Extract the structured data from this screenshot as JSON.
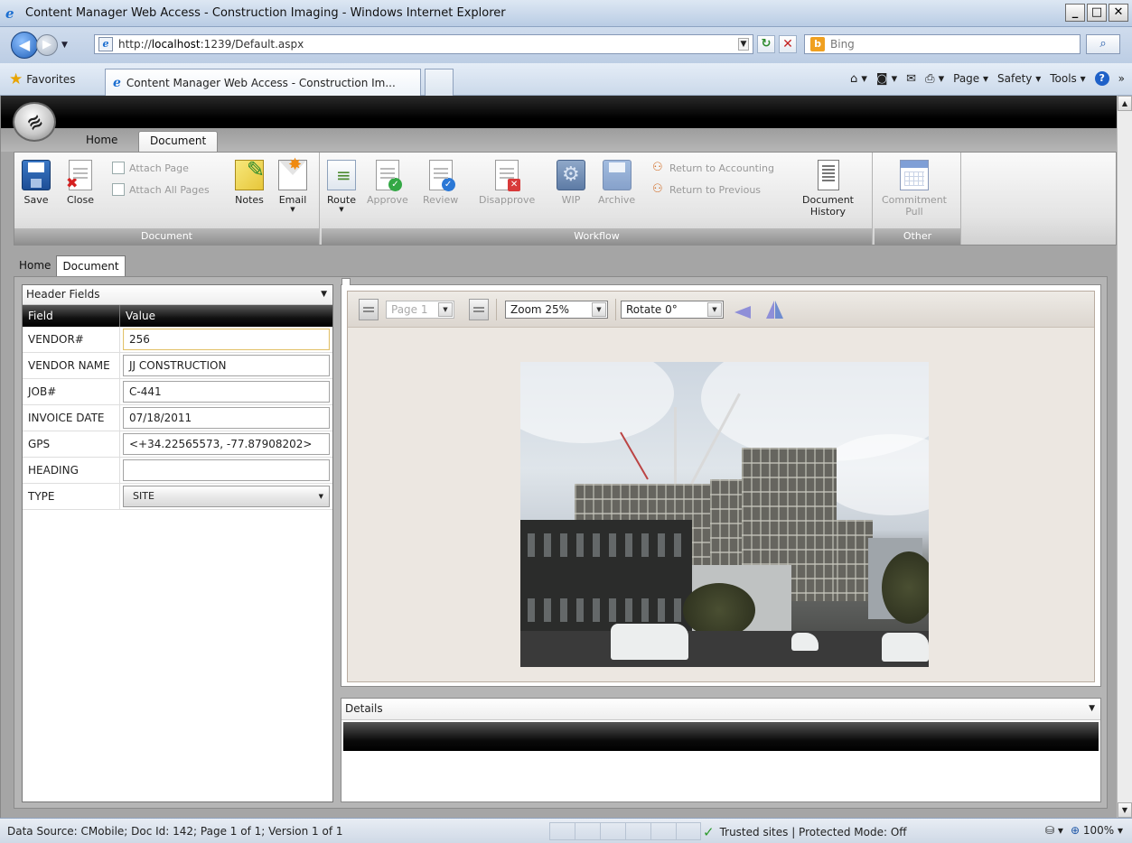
{
  "browser": {
    "window_title": "Content Manager Web Access - Construction Imaging - Windows Internet Explorer",
    "url_prefix": "http://",
    "url_host": "localhost",
    "url_rest": ":1239/Default.aspx",
    "search_placeholder": "Bing",
    "favorites_label": "Favorites",
    "tab_title": "Content Manager Web Access - Construction Im...",
    "cmd_page": "Page ▾",
    "cmd_safety": "Safety ▾",
    "cmd_tools": "Tools ▾",
    "win_min": "_",
    "win_max": "□",
    "win_close": "✕"
  },
  "ribbon": {
    "tabs": {
      "home": "Home",
      "document": "Document"
    },
    "groups": {
      "document": "Document",
      "workflow": "Workflow",
      "other": "Other"
    },
    "buttons": {
      "save": "Save",
      "close": "Close",
      "attach_page": "Attach Page",
      "attach_all_pages": "Attach All Pages",
      "notes": "Notes",
      "email": "Email",
      "route": "Route",
      "approve": "Approve",
      "review": "Review",
      "disapprove": "Disapprove",
      "wip": "WIP",
      "archive": "Archive",
      "return_to_accounting": "Return to Accounting",
      "return_to_previous": "Return to Previous",
      "document_history_1": "Document",
      "document_history_2": "History",
      "commitment_pull_1": "Commitment",
      "commitment_pull_2": "Pull"
    }
  },
  "page_tabs": {
    "home": "Home",
    "document": "Document"
  },
  "header_fields": {
    "panel_title": "Header Fields",
    "col_field": "Field",
    "col_value": "Value",
    "rows": [
      {
        "field": "VENDOR#",
        "value": "256"
      },
      {
        "field": "VENDOR NAME",
        "value": "JJ CONSTRUCTION"
      },
      {
        "field": "JOB#",
        "value": "C-441"
      },
      {
        "field": "INVOICE DATE",
        "value": "07/18/2011"
      },
      {
        "field": "GPS",
        "value": "<+34.22565573, -77.87908202>"
      },
      {
        "field": "HEADING",
        "value": ""
      },
      {
        "field": "TYPE",
        "value": "SITE"
      }
    ]
  },
  "viewer": {
    "page_select": "Page 1",
    "zoom_select": "Zoom 25%",
    "rotate_select": "Rotate 0°"
  },
  "details": {
    "panel_title": "Details"
  },
  "status": {
    "text": "Data Source: CMobile; Doc Id: 142; Page 1 of 1; Version 1 of 1",
    "zone": "Trusted sites | Protected Mode: Off",
    "zoom": "100%"
  }
}
